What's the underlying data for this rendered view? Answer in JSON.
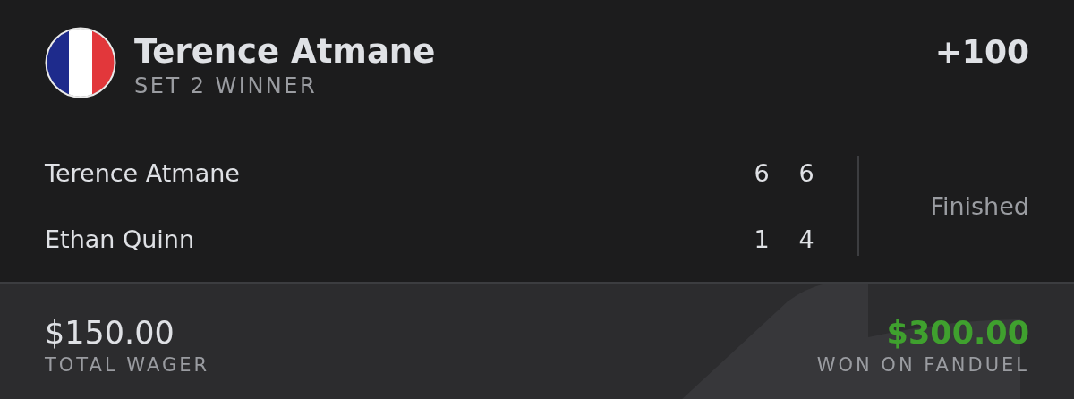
{
  "bet": {
    "selection": "Terence Atmane",
    "market": "SET 2 WINNER",
    "odds": "+100"
  },
  "scoreboard": {
    "players": [
      {
        "name": "Terence Atmane",
        "sets": [
          "6",
          "6"
        ]
      },
      {
        "name": "Ethan Quinn",
        "sets": [
          "1",
          "4"
        ]
      }
    ],
    "status": "Finished"
  },
  "footer": {
    "wager": {
      "amount": "$150.00",
      "label": "TOTAL WAGER"
    },
    "payout": {
      "amount": "$300.00",
      "label": "WON ON FANDUEL"
    }
  }
}
